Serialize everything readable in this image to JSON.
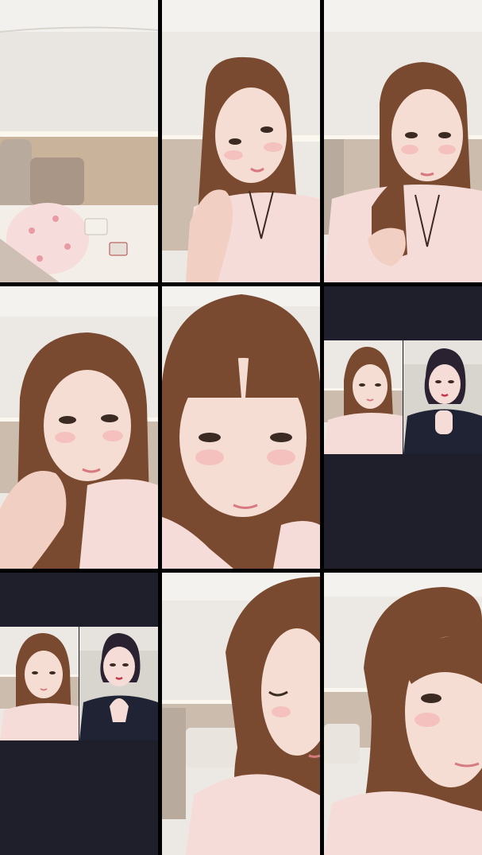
{
  "grid": {
    "rows": 3,
    "columns": 3
  },
  "colors": {
    "background": "#000000",
    "divider": "#000000",
    "dark_panel": "#1e1f2b",
    "wall": "#ece8e3",
    "headboard": "#c9b39a",
    "pajama": "#f6dcd8",
    "hair": "#7a4a30",
    "skin": "#f6ddd3"
  },
  "cells": [
    {
      "content": "empty-bed-room"
    },
    {
      "content": "woman-hand-on-neck"
    },
    {
      "content": "woman-holding-hair"
    },
    {
      "content": "woman-hand-on-cheek"
    },
    {
      "content": "woman-closeup-looking-down"
    },
    {
      "content": "split-screen-two-women"
    },
    {
      "content": "split-screen-two-women"
    },
    {
      "content": "woman-winking-side"
    },
    {
      "content": "woman-closeup-face"
    }
  ]
}
